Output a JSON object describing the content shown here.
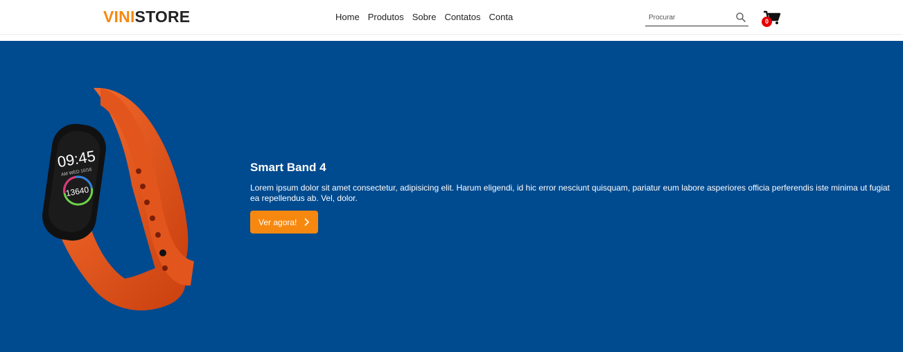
{
  "brand": {
    "part1": "VINI",
    "part2": "STORE",
    "accent_color": "#f7880f"
  },
  "nav": {
    "items": [
      "Home",
      "Produtos",
      "Sobre",
      "Contatos",
      "Conta"
    ]
  },
  "search": {
    "placeholder": "Procurar",
    "icon": "search-icon"
  },
  "cart": {
    "count": "0",
    "icon": "cart-icon"
  },
  "hero": {
    "background": "#004a8f",
    "title": "Smart Band 4",
    "description": "Lorem ipsum dolor sit amet consectetur, adipisicing elit. Harum eligendi, id hic error nesciunt quisquam, pariatur eum labore asperiores officia perferendis iste minima ut fugiat ea repellendus ab. Vel, dolor.",
    "cta_label": "Ver agora!",
    "product_image": {
      "time": "09:45",
      "date": "AM WED 10/16",
      "steps": "13640",
      "strap_color": "#e2561d"
    }
  }
}
